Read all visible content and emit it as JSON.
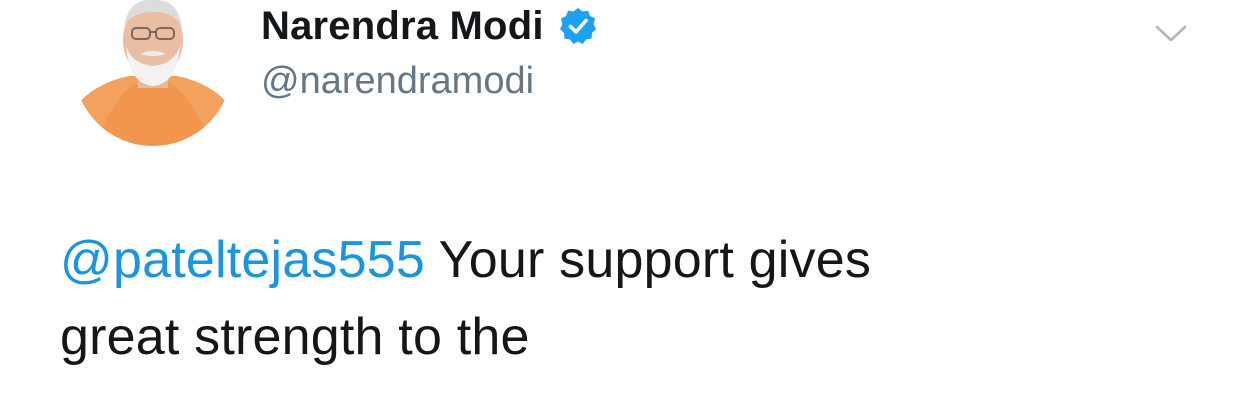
{
  "author": {
    "display_name": "Narendra Modi",
    "handle": "@narendramodi",
    "verified": true,
    "avatar": "profile-photo"
  },
  "tweet": {
    "mention": "@pateltejas555",
    "text_line1": " Your support gives",
    "text_line2": "great strength to the"
  },
  "icons": {
    "verified": "verified-badge-icon",
    "menu": "chevron-down-icon"
  },
  "colors": {
    "mention": "#1b95e0",
    "verified_badge": "#1da1f2",
    "handle": "#657786",
    "text": "#14171a",
    "background": "#ffffff"
  }
}
